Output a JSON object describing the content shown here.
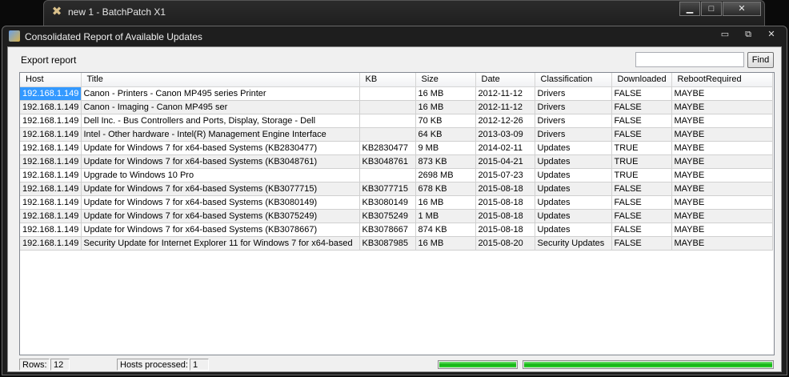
{
  "background_window": {
    "title": "new 1 - BatchPatch X1"
  },
  "window": {
    "title": "Consolidated Report of Available Updates",
    "controls": {
      "minimize": "▭",
      "restore": "⧉",
      "close": "✕"
    }
  },
  "toolbar": {
    "export_label": "Export report",
    "search": {
      "value": "",
      "placeholder": ""
    },
    "find_label": "Find"
  },
  "table": {
    "columns": [
      "Host",
      "Title",
      "KB",
      "Size",
      "Date",
      "Classification",
      "Downloaded",
      "RebootRequired"
    ],
    "rows": [
      [
        "192.168.1.149",
        "Canon - Printers - Canon MP495 series Printer",
        "",
        "16 MB",
        "2012-11-12",
        "Drivers",
        "FALSE",
        "MAYBE"
      ],
      [
        "192.168.1.149",
        "Canon - Imaging - Canon MP495 ser",
        "",
        "16 MB",
        "2012-11-12",
        "Drivers",
        "FALSE",
        "MAYBE"
      ],
      [
        "192.168.1.149",
        "Dell Inc. - Bus Controllers and Ports, Display, Storage - Dell",
        "",
        "70 KB",
        "2012-12-26",
        "Drivers",
        "FALSE",
        "MAYBE"
      ],
      [
        "192.168.1.149",
        "Intel - Other hardware - Intel(R) Management Engine Interface",
        "",
        "64 KB",
        "2013-03-09",
        "Drivers",
        "FALSE",
        "MAYBE"
      ],
      [
        "192.168.1.149",
        "Update for Windows 7 for x64-based Systems (KB2830477)",
        "KB2830477",
        "9 MB",
        "2014-02-11",
        "Updates",
        "TRUE",
        "MAYBE"
      ],
      [
        "192.168.1.149",
        "Update for Windows 7 for x64-based Systems (KB3048761)",
        "KB3048761",
        "873 KB",
        "2015-04-21",
        "Updates",
        "TRUE",
        "MAYBE"
      ],
      [
        "192.168.1.149",
        "Upgrade to Windows 10 Pro",
        "",
        "2698 MB",
        "2015-07-23",
        "Updates",
        "TRUE",
        "MAYBE"
      ],
      [
        "192.168.1.149",
        "Update for Windows 7 for x64-based Systems (KB3077715)",
        "KB3077715",
        "678 KB",
        "2015-08-18",
        "Updates",
        "FALSE",
        "MAYBE"
      ],
      [
        "192.168.1.149",
        "Update for Windows 7 for x64-based Systems (KB3080149)",
        "KB3080149",
        "16 MB",
        "2015-08-18",
        "Updates",
        "FALSE",
        "MAYBE"
      ],
      [
        "192.168.1.149",
        "Update for Windows 7 for x64-based Systems (KB3075249)",
        "KB3075249",
        "1 MB",
        "2015-08-18",
        "Updates",
        "FALSE",
        "MAYBE"
      ],
      [
        "192.168.1.149",
        "Update for Windows 7 for x64-based Systems (KB3078667)",
        "KB3078667",
        "874 KB",
        "2015-08-18",
        "Updates",
        "FALSE",
        "MAYBE"
      ],
      [
        "192.168.1.149",
        "Security Update for Internet Explorer 11 for Windows 7 for x64-based",
        "KB3087985",
        "16 MB",
        "2015-08-20",
        "Security Updates",
        "FALSE",
        "MAYBE"
      ]
    ],
    "selected_row": 0
  },
  "status": {
    "rows_label": "Rows:",
    "rows_value": "12",
    "hosts_label": "Hosts processed:",
    "hosts_value": "1",
    "progress_1": 1.0,
    "progress_2": 1.0,
    "progress_color": "#10b010"
  },
  "colors": {
    "selection": "#3399ff",
    "alt_row": "#f0f0f0"
  }
}
